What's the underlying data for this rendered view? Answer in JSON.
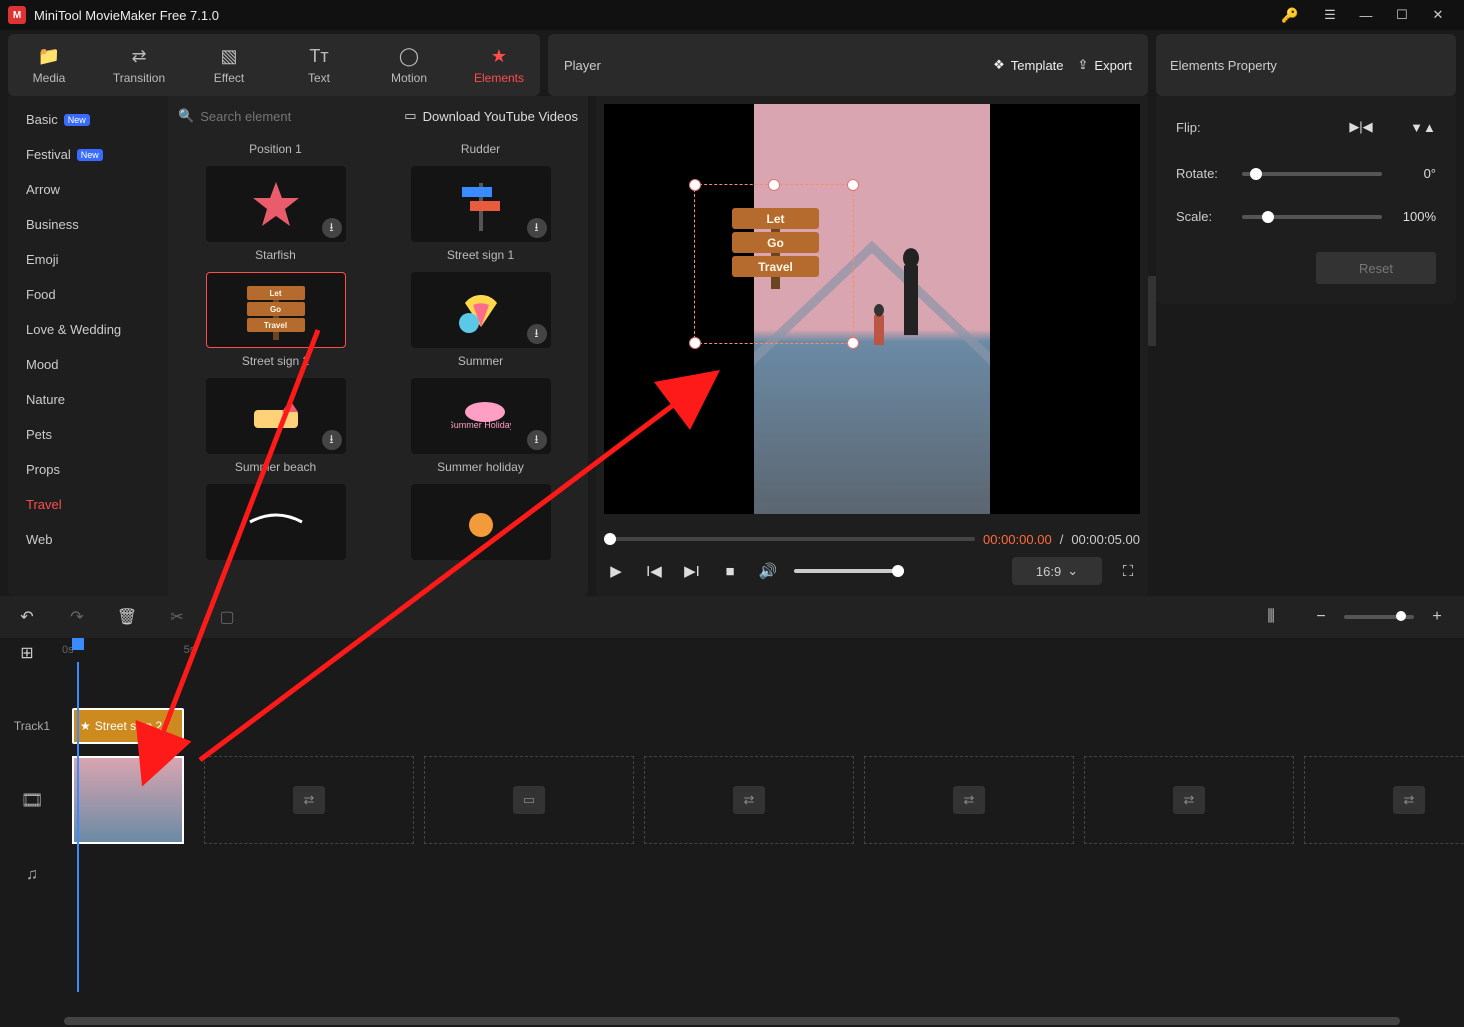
{
  "titlebar": {
    "app_title": "MiniTool MovieMaker Free 7.1.0"
  },
  "tabs": {
    "media": "Media",
    "transition": "Transition",
    "effect": "Effect",
    "text": "Text",
    "motion": "Motion",
    "elements": "Elements"
  },
  "playerbar": {
    "title": "Player",
    "template": "Template",
    "export": "Export"
  },
  "propheader": {
    "title": "Elements Property"
  },
  "categories": [
    {
      "label": "Basic",
      "badge": "New"
    },
    {
      "label": "Festival",
      "badge": "New"
    },
    {
      "label": "Arrow"
    },
    {
      "label": "Business"
    },
    {
      "label": "Emoji"
    },
    {
      "label": "Food"
    },
    {
      "label": "Love & Wedding"
    },
    {
      "label": "Mood"
    },
    {
      "label": "Nature"
    },
    {
      "label": "Pets"
    },
    {
      "label": "Props"
    },
    {
      "label": "Travel",
      "active": true
    },
    {
      "label": "Web"
    }
  ],
  "search": {
    "placeholder": "Search element"
  },
  "download_yt": "Download YouTube Videos",
  "elements_grid": {
    "r0": {
      "a": "Position 1",
      "b": "Rudder"
    },
    "r1": {
      "a": "Starfish",
      "b": "Street sign 1"
    },
    "r2": {
      "a": "Street sign 2",
      "b": "Summer"
    },
    "r3": {
      "a": "Summer beach",
      "b": "Summer holiday"
    }
  },
  "sign_text": {
    "p1": "Let",
    "p2": "Go",
    "p3": "Travel"
  },
  "player": {
    "current": "00:00:00.00",
    "sep": "/",
    "duration": "00:00:05.00",
    "aspect": "16:9"
  },
  "props": {
    "flip": "Flip:",
    "rotate": "Rotate:",
    "rotate_val": "0°",
    "scale": "Scale:",
    "scale_val": "100%",
    "reset": "Reset"
  },
  "ruler": {
    "t0": "0s",
    "t1": "5s"
  },
  "track1_label": "Track1",
  "clip_label": "Street sign 2"
}
